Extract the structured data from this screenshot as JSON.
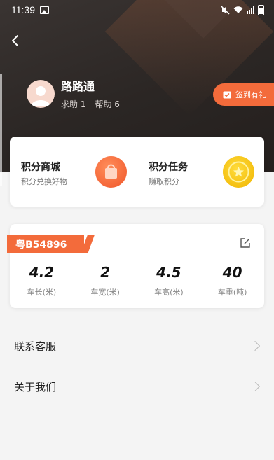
{
  "status_bar": {
    "time": "11:39"
  },
  "user": {
    "name": "路路通",
    "help_requests": "求助 1",
    "helped": "帮助 6"
  },
  "checkin": {
    "label": "签到有礼"
  },
  "points": {
    "shop": {
      "title": "积分商城",
      "subtitle": "积分兑换好物",
      "icon": "shopping-bag-icon"
    },
    "tasks": {
      "title": "积分任务",
      "subtitle": "赚取积分",
      "icon": "coin-star-icon"
    }
  },
  "vehicle": {
    "plate": "粤B54896",
    "specs": [
      {
        "value": "4.2",
        "label": "车长(米)"
      },
      {
        "value": "2",
        "label": "车宽(米)"
      },
      {
        "value": "4.5",
        "label": "车高(米)"
      },
      {
        "value": "40",
        "label": "车重(吨)"
      }
    ]
  },
  "menu": [
    {
      "label": "联系客服"
    },
    {
      "label": "关于我们"
    }
  ],
  "colors": {
    "accent": "#f36b3b",
    "header_bg": "#2b2624",
    "coin": "#f5c400"
  }
}
